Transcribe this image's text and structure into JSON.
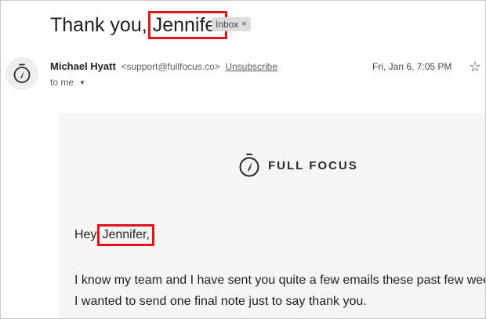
{
  "email": {
    "subject_prefix": "Thank you,",
    "subject_name": "Jennifer",
    "label_chip": "Inbox",
    "label_chip_close": "×",
    "sender_name": "Michael Hyatt",
    "sender_email": "<support@fullfocus.co>",
    "unsubscribe": "Unsubscribe",
    "recipient": "to me",
    "date": "Fri, Jan 6, 7:05 PM",
    "star_icon": "☆"
  },
  "body": {
    "brand_name": "FULL FOCUS",
    "greeting_prefix": "Hey",
    "greeting_name": "Jennifer,",
    "line1": "I know my team and I have sent you quite a few emails these past few wee",
    "line2": "I wanted to send one final note just to say thank you."
  },
  "colors": {
    "highlight": "#e0141a",
    "panel_bg": "#f6f5f3",
    "chip_bg": "#dddddd"
  },
  "icons": {
    "avatar": "compass-icon",
    "brand": "compass-icon",
    "recipient": "caret-down-icon",
    "star": "star-icon"
  }
}
